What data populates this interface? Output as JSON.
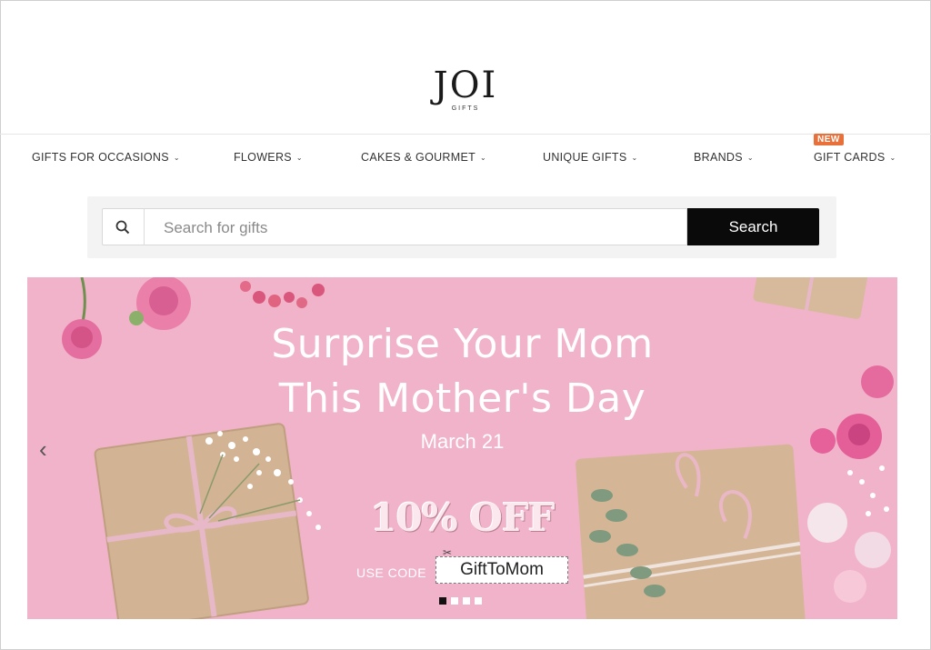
{
  "logo": {
    "main": "JOI",
    "sub": "GIFTS"
  },
  "nav": {
    "items": [
      {
        "label": "GIFTS FOR OCCASIONS"
      },
      {
        "label": "FLOWERS"
      },
      {
        "label": "CAKES & GOURMET"
      },
      {
        "label": "UNIQUE GIFTS"
      },
      {
        "label": "BRANDS"
      },
      {
        "label": "GIFT CARDS"
      }
    ],
    "new_badge": "NEW"
  },
  "search": {
    "placeholder": "Search for gifts",
    "button": "Search"
  },
  "banner": {
    "headline_1": "Surprise Your Mom",
    "headline_2": "This Mother's Day",
    "date": "March 21",
    "offer": "10% OFF",
    "code_label": "USE CODE",
    "code": "GiftToMom",
    "slide_count": 4,
    "active_slide": 1
  },
  "colors": {
    "banner_bg": "#f1b3c9",
    "badge": "#e8703a",
    "search_button": "#0a0a0a"
  },
  "icons": [
    "search-icon",
    "chevron-down-icon",
    "chevron-left-icon"
  ]
}
